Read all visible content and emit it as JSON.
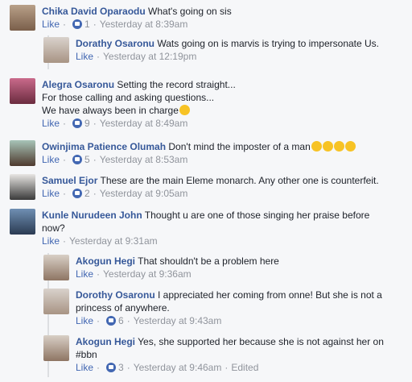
{
  "comments": [
    {
      "name": "Chika David Oparaodu",
      "text": "What's going on sis",
      "like": "Like",
      "reactions": "1",
      "time": "Yesterday at 8:39am"
    },
    {
      "name": "Dorathy Osaronu",
      "text": "Wats going on is marvis is trying to impersonate Us.",
      "like": "Like",
      "time": "Yesterday at 12:19pm"
    },
    {
      "name": "Alegra Osaronu",
      "text_lines": [
        "Setting the record straight...",
        "For those calling and asking questions...",
        "We have always been in charge"
      ],
      "like": "Like",
      "reactions": "9",
      "time": "Yesterday at 8:49am"
    },
    {
      "name": "Owinjima Patience Olumah",
      "text": "Don't mind the imposter of a man",
      "like": "Like",
      "reactions": "5",
      "time": "Yesterday at 8:53am"
    },
    {
      "name": "Samuel Ejor",
      "text": "These are the main Eleme monarch. Any other one is counterfeit.",
      "like": "Like",
      "reactions": "2",
      "time": "Yesterday at 9:05am"
    },
    {
      "name": "Kunle Nurudeen John",
      "text_line1": "Thought u are one of those singing her praise before",
      "text_line2": "now?",
      "like": "Like",
      "time": "Yesterday at 9:31am"
    },
    {
      "name": "Akogun Hegi",
      "text": "That shouldn't be a problem here",
      "like": "Like",
      "time": "Yesterday at 9:36am"
    },
    {
      "name": "Dorothy Osaronu",
      "text_line1": "I appreciated her coming from onne! But she is not a",
      "text_line2": "princess of anywhere.",
      "like": "Like",
      "reactions": "6",
      "time": "Yesterday at 9:43am"
    },
    {
      "name": "Akogun Hegi",
      "text_line1": "Yes, she supported her because she is not against her on",
      "text_line2": "#bbn",
      "like": "Like",
      "reactions": "3",
      "time": "Yesterday at 9:46am",
      "edited": "Edited"
    }
  ],
  "separator": "·",
  "colors": {
    "link": "#365899",
    "like": "#4267b2",
    "meta": "#90949c",
    "background": "#f6f7f9"
  }
}
